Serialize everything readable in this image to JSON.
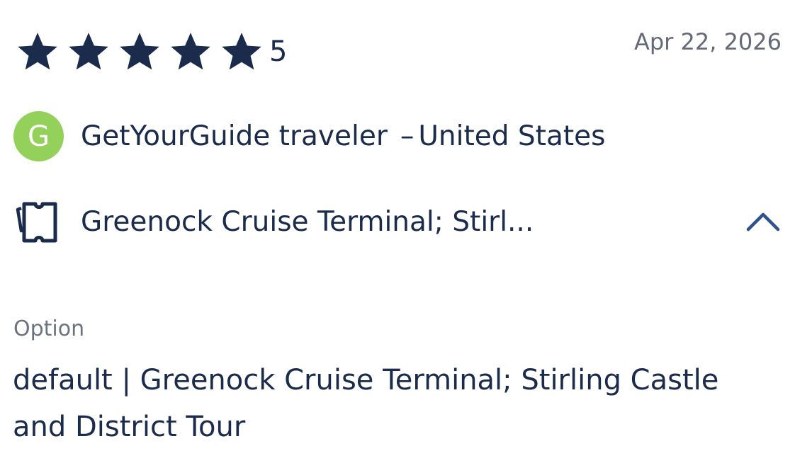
{
  "review": {
    "rating_value": "5",
    "rating_fraction": 1.0,
    "star_count": 5,
    "date": "Apr 22, 2026",
    "reviewer": {
      "avatar_letter": "G",
      "name": "GetYourGuide traveler",
      "separator": "–",
      "country": "United States"
    },
    "activity_title": "Greenock Cruise Terminal; Stirl...",
    "option_label": "Option",
    "option_value": "default | Greenock Cruise Terminal; Stirling Castle and District Tour"
  },
  "icons": {
    "star": "star-icon",
    "ticket": "ticket-icon",
    "collapse": "chevron-up-icon"
  },
  "colors": {
    "text_primary": "#1a2b4b",
    "text_secondary": "#646a78",
    "avatar_bg": "#93d15b",
    "chevron": "#2f5190"
  }
}
